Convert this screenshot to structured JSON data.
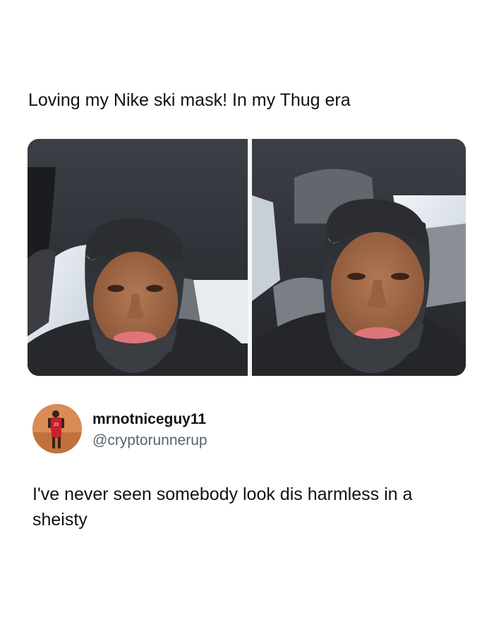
{
  "post": {
    "caption": "Loving my Nike ski mask! In my Thug era"
  },
  "media": {
    "panels": [
      "left-selfie",
      "right-selfie"
    ],
    "icons": [
      "swoosh-logo-icon"
    ]
  },
  "reply": {
    "display_name": "mrnotniceguy11",
    "handle": "@cryptorunnerup",
    "text": "I've never seen somebody look dis harmless in a sheisty",
    "avatar": {
      "jersey_number": "23",
      "jersey_color": "#c8202f",
      "background_color": "#d98c55"
    }
  },
  "colors": {
    "background": "#ffffff",
    "text_primary": "#0f1419",
    "text_secondary": "#536471"
  }
}
